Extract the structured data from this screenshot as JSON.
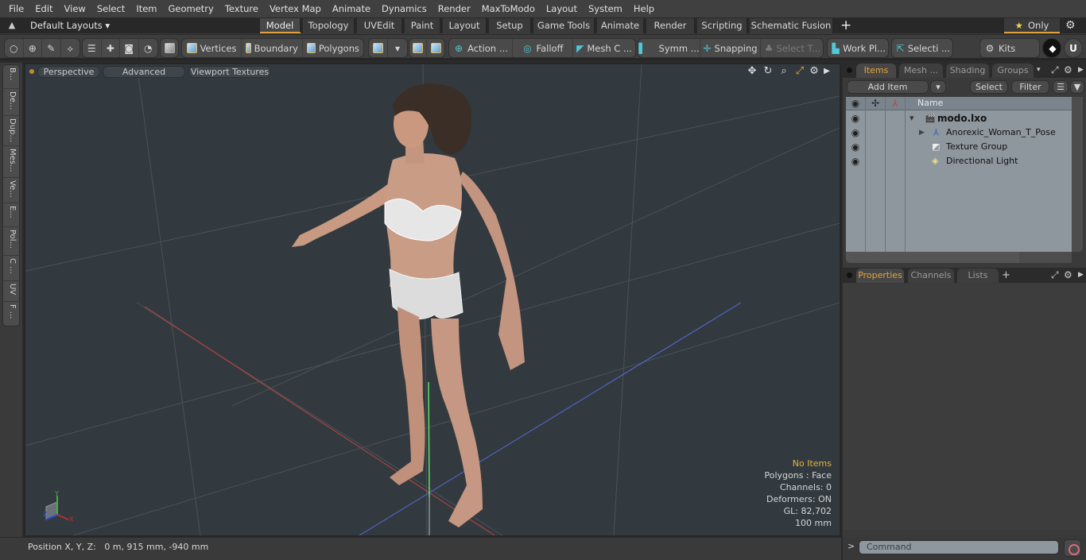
{
  "menu": [
    "File",
    "Edit",
    "View",
    "Select",
    "Item",
    "Geometry",
    "Texture",
    "Vertex Map",
    "Animate",
    "Dynamics",
    "Render",
    "MaxToModo",
    "Layout",
    "System",
    "Help"
  ],
  "layout_bar": {
    "layouts_label": "Default Layouts",
    "tabs": [
      {
        "label": "Model",
        "active": true
      },
      {
        "label": "Topology"
      },
      {
        "label": "UVEdit"
      },
      {
        "label": "Paint"
      },
      {
        "label": "Layout"
      },
      {
        "label": "Setup"
      },
      {
        "label": "Game Tools"
      },
      {
        "label": "Animate"
      },
      {
        "label": "Render"
      },
      {
        "label": "Scripting"
      },
      {
        "label": "Schematic Fusion"
      }
    ],
    "add_tab": "+",
    "only_label": "Only",
    "accent": "#e0a040"
  },
  "toolbar": {
    "vertices": "Vertices",
    "boundary": "Boundary",
    "polygons": "Polygons",
    "action": "Action",
    "falloff": "Falloff",
    "mesh_constraints": "Mesh C ...",
    "symmetry": "Symm ...",
    "snapping": "Snapping",
    "select_through": "Select T...",
    "work_plane": "Work Pl...",
    "selection_sets": "Selecti ...",
    "kits": "Kits",
    "ellipsis": "..."
  },
  "left_strip": [
    "B...",
    "De...",
    "Dup...",
    "Mes...",
    "Ve...",
    "E...",
    "Pol...",
    "C ...",
    "UV",
    "F ..."
  ],
  "viewport": {
    "view_mode": "Perspective",
    "shading": "Advanced",
    "textures": "Viewport Textures",
    "info": {
      "selection": "No Items",
      "polygons": "Polygons : Face",
      "channels": "Channels: 0",
      "deformers": "Deformers: ON",
      "gl": "GL: 82,702",
      "grid": "100 mm"
    },
    "axis_labels": {
      "x": "X",
      "y": "Y",
      "z": "Z"
    }
  },
  "status": {
    "position_label": "Position X, Y, Z:",
    "position_value": "0 m, 915 mm, -940 mm"
  },
  "items_panel": {
    "tabs": [
      {
        "label": "Items",
        "active": true
      },
      {
        "label": "Mesh ..."
      },
      {
        "label": "Shading"
      },
      {
        "label": "Groups"
      }
    ],
    "add_item": "Add Item",
    "select": "Select",
    "filter": "Filter",
    "column_name": "Name",
    "tree": [
      {
        "name": "modo.lxo",
        "type": "scene",
        "level": 0,
        "expanded": true
      },
      {
        "name": "Anorexic_Woman_T_Pose",
        "type": "mesh",
        "level": 1,
        "collapsed": true
      },
      {
        "name": "Texture Group",
        "type": "texture-group",
        "level": 1
      },
      {
        "name": "Directional Light",
        "type": "light",
        "level": 1
      }
    ]
  },
  "properties_panel": {
    "tabs": [
      {
        "label": "Properties",
        "active": true
      },
      {
        "label": "Channels"
      },
      {
        "label": "Lists"
      }
    ],
    "add_tab": "+"
  },
  "command": {
    "prompt": ">",
    "placeholder": "Command"
  }
}
